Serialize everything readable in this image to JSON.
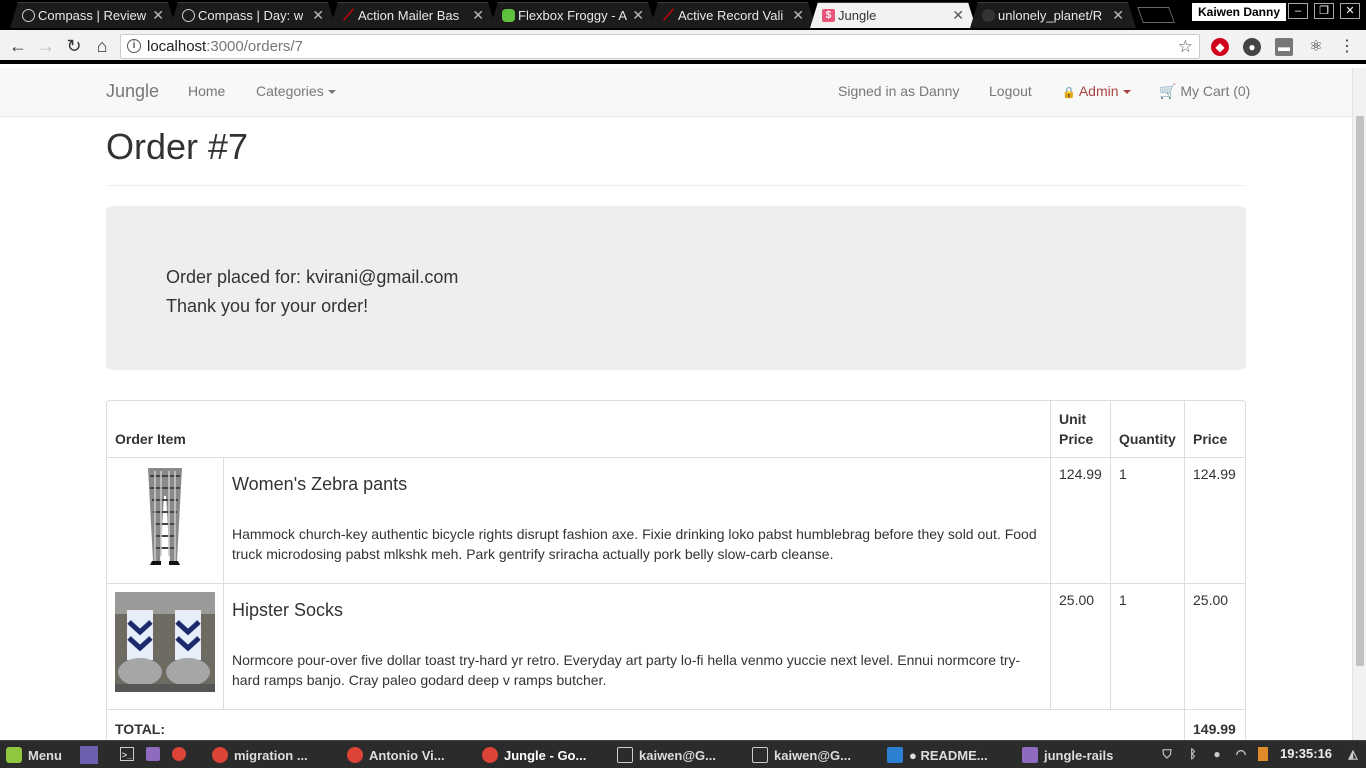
{
  "browser": {
    "tabs": [
      {
        "title": "Compass | Review",
        "icon": "compass-icon",
        "color": "#555555"
      },
      {
        "title": "Compass | Day: w",
        "icon": "compass-icon",
        "color": "#555555"
      },
      {
        "title": "Action Mailer Bas",
        "icon": "rails-icon",
        "color": "#cc0000"
      },
      {
        "title": "Flexbox Froggy - A",
        "icon": "frog-icon",
        "color": "#5fbf3f"
      },
      {
        "title": "Active Record Vali",
        "icon": "rails-icon",
        "color": "#cc0000"
      },
      {
        "title": "Jungle",
        "icon": "jungle-favicon-icon",
        "color": "#e8547a"
      },
      {
        "title": "unlonely_planet/R",
        "icon": "github-icon",
        "color": "#333333"
      }
    ],
    "active_tab_index": 5,
    "user_chip": "Kaiwen Danny",
    "url_host": "localhost",
    "url_path": ":3000/orders/7"
  },
  "navbar": {
    "brand": "Jungle",
    "home": "Home",
    "categories": "Categories",
    "signed_in": "Signed in as Danny",
    "logout": "Logout",
    "admin": "Admin",
    "cart": "My Cart (0)"
  },
  "order": {
    "title": "Order #7",
    "placed_for": "Order placed for: kvirani@gmail.com",
    "thanks": "Thank you for your order!"
  },
  "table": {
    "headers": {
      "item": "Order Item",
      "unit_price_1": "Unit",
      "unit_price_2": "Price",
      "quantity": "Quantity",
      "price": "Price"
    },
    "items": [
      {
        "name": "Women's Zebra pants",
        "description": "Hammock church-key authentic bicycle rights disrupt fashion axe. Fixie drinking loko pabst humblebrag before they sold out. Food truck microdosing pabst mlkshk meh. Park gentrify sriracha actually pork belly slow-carb cleanse.",
        "unit_price": "124.99",
        "quantity": "1",
        "price": "124.99"
      },
      {
        "name": "Hipster Socks",
        "description": "Normcore pour-over five dollar toast try-hard yr retro. Everyday art party lo-fi hella venmo yuccie next level. Ennui normcore try-hard ramps banjo. Cray paleo godard deep v ramps butcher.",
        "unit_price": "25.00",
        "quantity": "1",
        "price": "25.00"
      }
    ],
    "total_label": "TOTAL:",
    "total_value": "149.99"
  },
  "taskbar": {
    "menu": "Menu",
    "items": [
      {
        "label": "migration ...",
        "icon": "chrome-icon"
      },
      {
        "label": "Antonio Vi...",
        "icon": "chrome-icon"
      },
      {
        "label": "Jungle - Go...",
        "icon": "chrome-icon"
      },
      {
        "label": "kaiwen@G...",
        "icon": "terminal-icon"
      },
      {
        "label": "kaiwen@G...",
        "icon": "terminal-icon"
      },
      {
        "label": "● README...",
        "icon": "vscode-icon"
      },
      {
        "label": "jungle-rails",
        "icon": "folder-icon"
      }
    ],
    "clock": "19:35:16"
  },
  "colors": {
    "admin": "#a94442",
    "navbar_bg": "#f8f8f8",
    "jumbotron_bg": "#eeeeee"
  }
}
